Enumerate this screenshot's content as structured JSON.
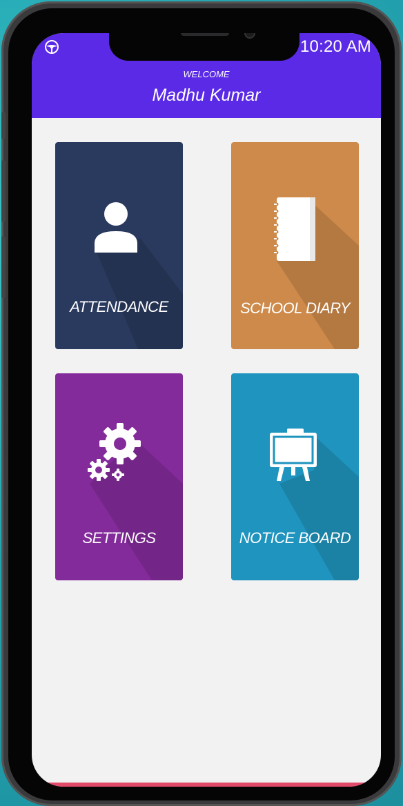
{
  "status_bar": {
    "time": "10:20 AM",
    "status_icon": "steering-wheel-icon"
  },
  "header": {
    "welcome": "WELCOME",
    "user_name": "Madhu Kumar",
    "background_color": "#5a2ae6"
  },
  "tiles": [
    {
      "label": "ATTENDANCE",
      "icon": "user-icon",
      "color": "#2a3a5e"
    },
    {
      "label": "SCHOOL DIARY",
      "icon": "notebook-icon",
      "color": "#cd8a4a"
    },
    {
      "label": "SETTINGS",
      "icon": "gears-icon",
      "color": "#842b9b"
    },
    {
      "label": "NOTICE BOARD",
      "icon": "easel-board-icon",
      "color": "#1f94be"
    }
  ]
}
